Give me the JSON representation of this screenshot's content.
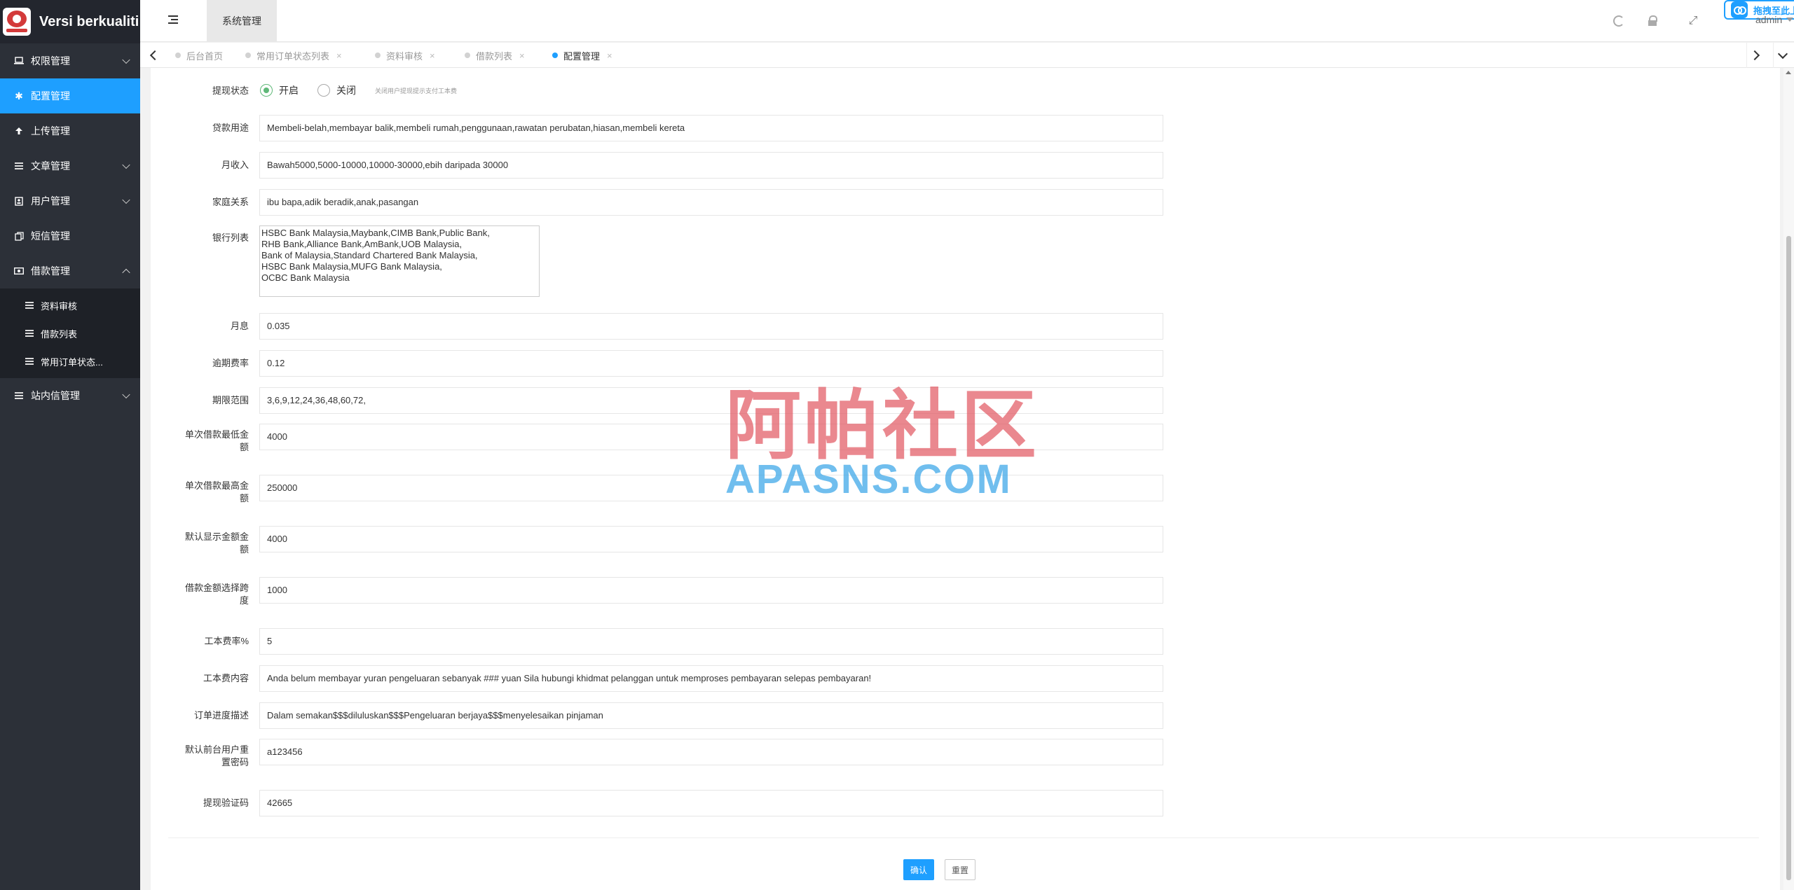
{
  "brand": {
    "title": "Versi berkualiti",
    "logo": "brand-logo"
  },
  "sidebar": {
    "items": [
      {
        "label": "权限管理",
        "icon": "laptop-icon"
      },
      {
        "label": "配置管理",
        "icon": "gear-icon"
      },
      {
        "label": "上传管理",
        "icon": "upload-icon"
      },
      {
        "label": "文章管理",
        "icon": "list-icon"
      },
      {
        "label": "用户管理",
        "icon": "user-card-icon"
      },
      {
        "label": "短信管理",
        "icon": "copy-icon"
      },
      {
        "label": "借款管理",
        "icon": "money-icon"
      },
      {
        "label": "站内信管理",
        "icon": "list-icon"
      }
    ],
    "subitems": [
      {
        "label": "资料审核"
      },
      {
        "label": "借款列表"
      },
      {
        "label": "常用订单状态..."
      }
    ]
  },
  "header": {
    "tab_label": "系统管理",
    "upload_label": "拖拽至此上传",
    "user": "admin"
  },
  "tabs": [
    {
      "label": "后台首页"
    },
    {
      "label": "常用订单状态列表"
    },
    {
      "label": "资料审核"
    },
    {
      "label": "借款列表"
    },
    {
      "label": "配置管理"
    }
  ],
  "tab_close": "×",
  "form": {
    "withdraw_status": {
      "label": "提现状态",
      "options": [
        "开启",
        "关闭"
      ],
      "selected": "开启",
      "hint": "关闭用户提现提示支付工本费"
    },
    "fields": [
      {
        "label": "贷款用途",
        "value": "Membeli-belah,membayar balik,membeli rumah,penggunaan,rawatan perubatan,hiasan,membeli kereta"
      },
      {
        "label": "月收入",
        "value": "Bawah5000,5000-10000,10000-30000,ebih daripada 30000"
      },
      {
        "label": "家庭关系",
        "value": "ibu bapa,adik beradik,anak,pasangan"
      },
      {
        "label": "月息",
        "value": "0.035"
      },
      {
        "label": "逾期费率",
        "value": "0.12"
      },
      {
        "label": "期限范围",
        "value": "3,6,9,12,24,36,48,60,72,"
      },
      {
        "label_line1": "单次借款最低金",
        "label_line2": "额",
        "value": "4000"
      },
      {
        "label_line1": "单次借款最高金",
        "label_line2": "额",
        "value": "250000"
      },
      {
        "label_line1": "默认显示金额金",
        "label_line2": "额",
        "value": "4000"
      },
      {
        "label_line1": "借款金额选择跨",
        "label_line2": "度",
        "value": "1000"
      },
      {
        "label": "工本费率%",
        "value": "5"
      },
      {
        "label": "工本费内容",
        "value": "Anda belum membayar yuran pengeluaran sebanyak ### yuan Sila hubungi khidmat pelanggan untuk memproses pembayaran selepas pembayaran!"
      },
      {
        "label": "订单进度描述",
        "value": "Dalam semakan$$$diluluskan$$$Pengeluaran berjaya$$$menyelesaikan pinjaman"
      },
      {
        "label_line1": "默认前台用户重",
        "label_line2": "置密码",
        "value": "a123456"
      },
      {
        "label": "提现验证码",
        "value": "42665"
      }
    ],
    "bank_list": {
      "label": "银行列表",
      "lines": [
        "HSBC Bank Malaysia,Maybank,CIMB Bank,Public Bank,",
        "RHB Bank,Alliance Bank,AmBank,UOB Malaysia,",
        "Bank of Malaysia,Standard Chartered Bank Malaysia,",
        "HSBC Bank Malaysia,MUFG Bank Malaysia,",
        "OCBC Bank Malaysia"
      ]
    },
    "confirm_label": "确认",
    "reset_label": "重置"
  },
  "watermark": {
    "cn": "阿帕社区",
    "en": "APASNS.COM"
  },
  "colors": {
    "accent": "#1e9fff",
    "sidebar": "#2c3038",
    "radio_checked": "#5fb878"
  }
}
